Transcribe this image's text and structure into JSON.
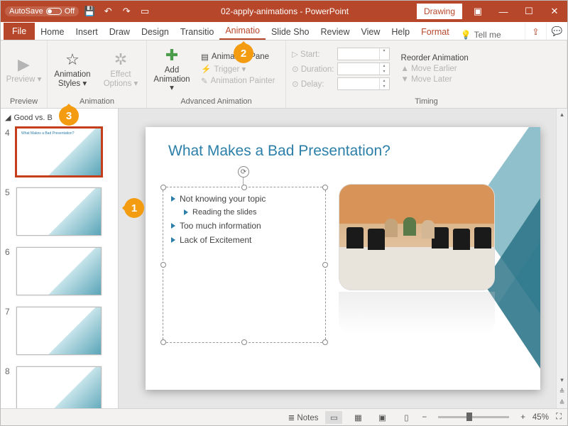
{
  "titlebar": {
    "autosave_label": "AutoSave",
    "autosave_state": "Off",
    "filename": "02-apply-animations",
    "appname": "PowerPoint",
    "mode": "Drawing"
  },
  "tabs": {
    "file": "File",
    "home": "Home",
    "insert": "Insert",
    "draw": "Draw",
    "design": "Design",
    "transitions": "Transitio",
    "animations": "Animatio",
    "slideshow": "Slide Sho",
    "review": "Review",
    "view": "View",
    "help": "Help",
    "format": "Format",
    "tellme": "Tell me"
  },
  "ribbon": {
    "preview": {
      "btn": "Preview ▾",
      "group": "Preview"
    },
    "animation": {
      "styles": "Animation Styles ▾",
      "effect": "Effect Options ▾",
      "group": "Animation"
    },
    "advanced": {
      "add": "Add Animation ▾",
      "pane": "Animation Pane",
      "trigger": "Trigger ▾",
      "painter": "Animation Painter",
      "group": "Advanced Animation"
    },
    "timing": {
      "start": "Start:",
      "duration": "Duration:",
      "delay": "Delay:",
      "reorder": "Reorder Animation",
      "earlier": "Move Earlier",
      "later": "Move Later",
      "group": "Timing"
    }
  },
  "thumbs": {
    "section": "Good vs. B",
    "nums": [
      "4",
      "5",
      "6",
      "7",
      "8"
    ]
  },
  "slide": {
    "title": "What Makes a Bad Presentation?",
    "b1": "Not knowing your topic",
    "b1a": "Reading the slides",
    "b2": "Too much information",
    "b3": "Lack of Excitement"
  },
  "status": {
    "notes": "Notes",
    "zoom": "45%"
  },
  "callouts": {
    "c1": "1",
    "c2": "2",
    "c3": "3"
  }
}
